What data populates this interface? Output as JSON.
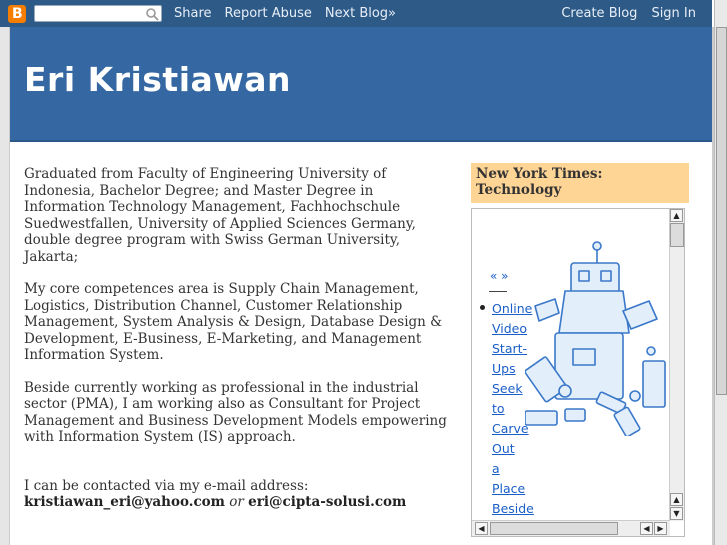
{
  "navbar": {
    "logo_letter": "B",
    "search_placeholder": "",
    "links_left": [
      "Share",
      "Report Abuse",
      "Next Blog»"
    ],
    "links_right": [
      "Create Blog",
      "Sign In"
    ]
  },
  "header": {
    "title": "Eri Kristiawan"
  },
  "main": {
    "p1": "Graduated from Faculty of Engineering University of Indonesia, Bachelor Degree; and Master Degree in Information Technology Management, Fachhochschule Suedwestfallen, University of Applied Sciences Germany, double degree program with Swiss German University, Jakarta;",
    "p2": "My core competences area is Supply Chain Management, Logistics, Distribution Channel, Customer Relationship Management, System Analysis & Design, Database Design & Development, E-Business, E-Marketing, and Management Information System.",
    "p3": "Beside currently working as professional in the industrial sector (PMA), I am working also as Consultant for Project Management and Business Development Models empowering with Information System (IS) approach.",
    "contact_intro": "I can be contacted via my e-mail address:",
    "email1": "kristiawan_eri@yahoo.com",
    "or": "or",
    "email2": "eri@cipta-solusi.com"
  },
  "sidebar": {
    "title": "New York Times: Technology",
    "feed_nav": "« »",
    "feed_item_words": [
      "Online",
      "Video",
      "Start-",
      "Ups",
      "Seek",
      "to",
      "Carve",
      "Out",
      "a",
      "Place",
      "Beside"
    ]
  },
  "colors": {
    "navbar": "#2e5a88",
    "header": "#3567a2",
    "sidebar_title_bg": "#ffd596",
    "link": "#1a5ec7"
  }
}
